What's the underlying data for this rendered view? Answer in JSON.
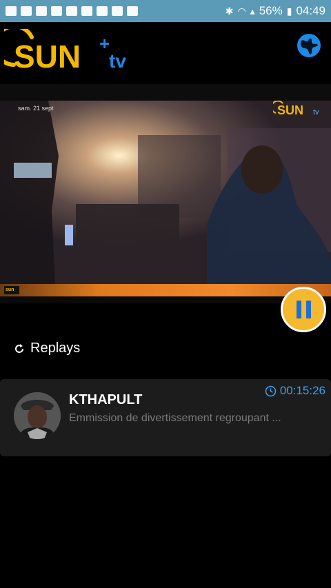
{
  "status_bar": {
    "battery": "56%",
    "time": "04:49",
    "icons": [
      "youtube-icon",
      "youtube-icon",
      "youtube-icon",
      "facebook-icon",
      "gallery-icon",
      "download-icon",
      "download-icon",
      "mail-icon",
      "cart-icon",
      "bluetooth-icon",
      "wifi-icon",
      "signal-icon",
      "battery-icon"
    ]
  },
  "header": {
    "logo_text": "SUN",
    "logo_plus": "+",
    "logo_tv": "tv",
    "accent_color": "#f5b800",
    "tv_color": "#1e88e5"
  },
  "video": {
    "overlay_date": "sam. 21 sept",
    "overlay_logo": "SUN",
    "overlay_logo_tv": "tv",
    "lower_logo": "sun"
  },
  "replays": {
    "label": "Replays"
  },
  "card": {
    "title": "KTHAPULT",
    "description": "Emmission de divertissement regroupant ...",
    "duration": "00:15:26"
  }
}
